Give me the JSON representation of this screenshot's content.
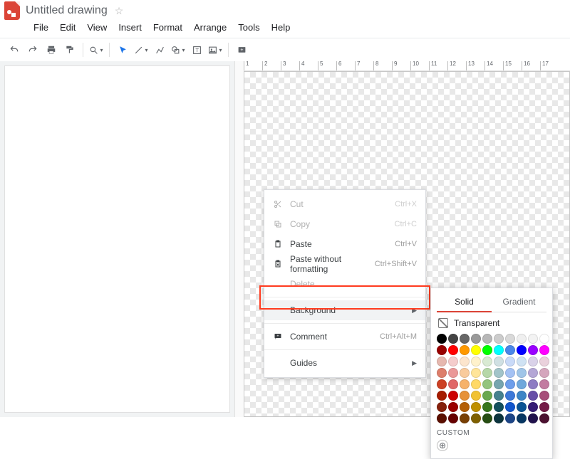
{
  "header": {
    "doc_title": "Untitled drawing",
    "star_icon": "☆"
  },
  "menubar": [
    "File",
    "Edit",
    "View",
    "Insert",
    "Format",
    "Arrange",
    "Tools",
    "Help"
  ],
  "toolbar_icons": [
    "undo-icon",
    "redo-icon",
    "print-icon",
    "paint-format-icon",
    "zoom-icon",
    "select-icon",
    "line-icon",
    "polyline-icon",
    "shape-icon",
    "textbox-icon",
    "image-icon",
    "comment-icon"
  ],
  "ruler_max": 17,
  "context_menu": {
    "items": [
      {
        "key": "cut",
        "icon": "scissors-icon",
        "label": "Cut",
        "shortcut": "Ctrl+X",
        "disabled": true
      },
      {
        "key": "copy",
        "icon": "copy-icon",
        "label": "Copy",
        "shortcut": "Ctrl+C",
        "disabled": true
      },
      {
        "key": "paste",
        "icon": "clipboard-icon",
        "label": "Paste",
        "shortcut": "Ctrl+V",
        "disabled": false
      },
      {
        "key": "paste_nofmt",
        "icon": "clipboard-clear-icon",
        "label": "Paste without formatting",
        "shortcut": "Ctrl+Shift+V",
        "disabled": false
      },
      {
        "key": "delete",
        "icon": "",
        "label": "Delete",
        "shortcut": "",
        "disabled": true
      },
      {
        "sep": true
      },
      {
        "key": "background",
        "icon": "",
        "label": "Background",
        "submenu": true,
        "hover": true
      },
      {
        "sep": true
      },
      {
        "key": "comment",
        "icon": "comment-icon",
        "label": "Comment",
        "shortcut": "Ctrl+Alt+M"
      },
      {
        "sep": true
      },
      {
        "key": "guides",
        "icon": "",
        "label": "Guides",
        "submenu": true
      }
    ]
  },
  "color_popup": {
    "tab_solid": "Solid",
    "tab_gradient": "Gradient",
    "transparent_label": "Transparent",
    "custom_label": "CUSTOM",
    "grays": [
      "#000000",
      "#434343",
      "#666666",
      "#999999",
      "#b7b7b7",
      "#cccccc",
      "#d9d9d9",
      "#efefef",
      "#f3f3f3",
      "#ffffff"
    ],
    "brights": [
      "#980000",
      "#ff0000",
      "#ff9900",
      "#ffff00",
      "#00ff00",
      "#00ffff",
      "#4a86e8",
      "#0000ff",
      "#9900ff",
      "#ff00ff"
    ],
    "shades": [
      [
        "#e6b8af",
        "#f4cccc",
        "#fce5cd",
        "#fff2cc",
        "#d9ead3",
        "#d0e0e3",
        "#c9daf8",
        "#cfe2f3",
        "#d9d2e9",
        "#ead1dc"
      ],
      [
        "#dd7e6b",
        "#ea9999",
        "#f9cb9c",
        "#ffe599",
        "#b6d7a8",
        "#a2c4c9",
        "#a4c2f4",
        "#9fc5e8",
        "#b4a7d6",
        "#d5a6bd"
      ],
      [
        "#cc4125",
        "#e06666",
        "#f6b26b",
        "#ffd966",
        "#93c47d",
        "#76a5af",
        "#6d9eeb",
        "#6fa8dc",
        "#8e7cc3",
        "#c27ba0"
      ],
      [
        "#a61c00",
        "#cc0000",
        "#e69138",
        "#f1c232",
        "#6aa84f",
        "#45818e",
        "#3c78d8",
        "#3d85c6",
        "#674ea7",
        "#a64d79"
      ],
      [
        "#85200c",
        "#990000",
        "#b45f06",
        "#bf9000",
        "#38761d",
        "#134f5c",
        "#1155cc",
        "#0b5394",
        "#351c75",
        "#741b47"
      ],
      [
        "#5b0f00",
        "#660000",
        "#783f04",
        "#7f6000",
        "#274e13",
        "#0c343d",
        "#1c4587",
        "#073763",
        "#20124d",
        "#4c1130"
      ]
    ]
  }
}
